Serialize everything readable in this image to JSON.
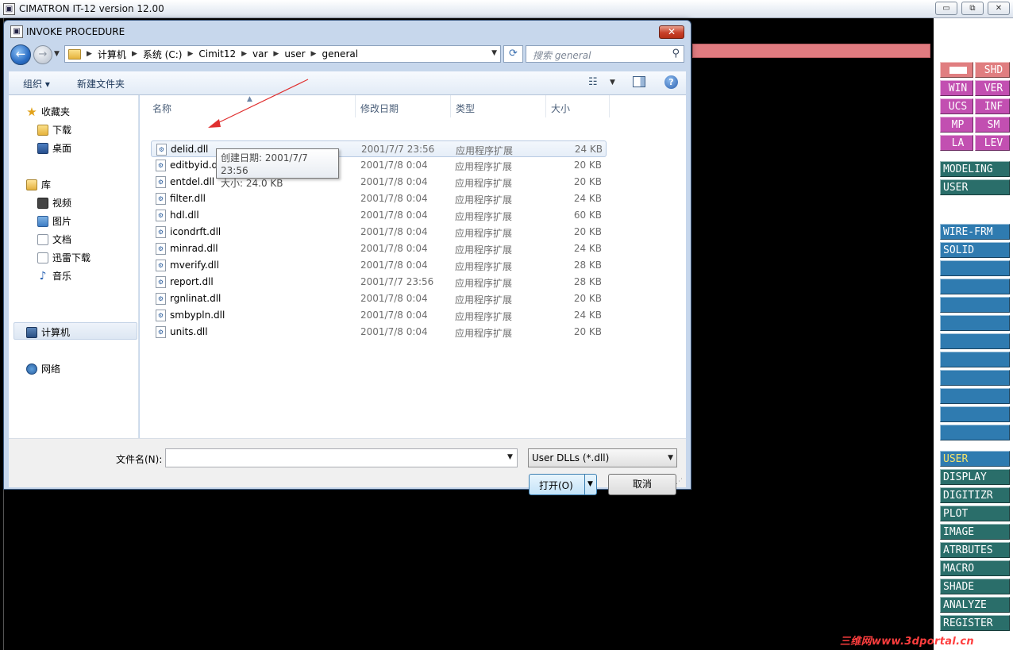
{
  "app": {
    "title": "CIMATRON IT-12 version 12.00",
    "window_buttons": {
      "minimize": "▭",
      "restore": "⧉",
      "close": "✕"
    }
  },
  "right_panel": {
    "top_grid": [
      [
        "",
        "SHD"
      ],
      [
        "WIN",
        "VER"
      ],
      [
        "UCS",
        "INF"
      ],
      [
        "MP",
        "SM"
      ],
      [
        "LA",
        "LEV"
      ]
    ],
    "mode_items": [
      "MODELING",
      "USER"
    ],
    "type_items": [
      "WIRE-FRM",
      "SOLID"
    ],
    "blank_count_note": "",
    "bottom_items": [
      "USER",
      "DISPLAY",
      "DIGITIZR",
      "PLOT",
      "IMAGE",
      "ATRBUTES",
      "MACRO",
      "SHADE",
      "ANALYZE",
      "REGISTER"
    ],
    "active_bottom": "USER"
  },
  "watermark": "三维网www.3dportal.cn",
  "dialog": {
    "title": "INVOKE PROCEDURE",
    "close_label": "✕",
    "breadcrumbs": [
      "计算机",
      "系统 (C:)",
      "Cimit12",
      "var",
      "user",
      "general"
    ],
    "search_placeholder": "搜索 general",
    "toolbar": {
      "organize": "组织 ▾",
      "new_folder": "新建文件夹"
    },
    "nav": {
      "favorites": "收藏夹",
      "downloads": "下载",
      "desktop": "桌面",
      "libraries": "库",
      "videos": "视频",
      "pictures": "图片",
      "documents": "文档",
      "xunlei": "迅雷下载",
      "music": "音乐",
      "computer": "计算机",
      "network": "网络"
    },
    "columns": {
      "name": "名称",
      "date": "修改日期",
      "type": "类型",
      "size": "大小"
    },
    "files": [
      {
        "name": "delid.dll",
        "date": "2001/7/7 23:56",
        "type": "应用程序扩展",
        "size": "24 KB"
      },
      {
        "name": "editbyid.dll",
        "date": "2001/7/8 0:04",
        "type": "应用程序扩展",
        "size": "20 KB"
      },
      {
        "name": "entdel.dll",
        "date": "2001/7/8 0:04",
        "type": "应用程序扩展",
        "size": "20 KB"
      },
      {
        "name": "filter.dll",
        "date": "2001/7/8 0:04",
        "type": "应用程序扩展",
        "size": "24 KB"
      },
      {
        "name": "hdl.dll",
        "date": "2001/7/8 0:04",
        "type": "应用程序扩展",
        "size": "60 KB"
      },
      {
        "name": "icondrft.dll",
        "date": "2001/7/8 0:04",
        "type": "应用程序扩展",
        "size": "20 KB"
      },
      {
        "name": "minrad.dll",
        "date": "2001/7/8 0:04",
        "type": "应用程序扩展",
        "size": "24 KB"
      },
      {
        "name": "mverify.dll",
        "date": "2001/7/8 0:04",
        "type": "应用程序扩展",
        "size": "28 KB"
      },
      {
        "name": "report.dll",
        "date": "2001/7/7 23:56",
        "type": "应用程序扩展",
        "size": "28 KB"
      },
      {
        "name": "rgnlinat.dll",
        "date": "2001/7/8 0:04",
        "type": "应用程序扩展",
        "size": "20 KB"
      },
      {
        "name": "smbypln.dll",
        "date": "2001/7/8 0:04",
        "type": "应用程序扩展",
        "size": "24 KB"
      },
      {
        "name": "units.dll",
        "date": "2001/7/8 0:04",
        "type": "应用程序扩展",
        "size": "20 KB"
      }
    ],
    "tooltip": {
      "created": "创建日期: 2001/7/7 23:56",
      "size": "大小: 24.0 KB"
    },
    "filename_label": "文件名(N):",
    "filename_value": "",
    "filetype_value": "User DLLs (*.dll)",
    "open_label": "打开(O)",
    "cancel_label": "取消"
  }
}
